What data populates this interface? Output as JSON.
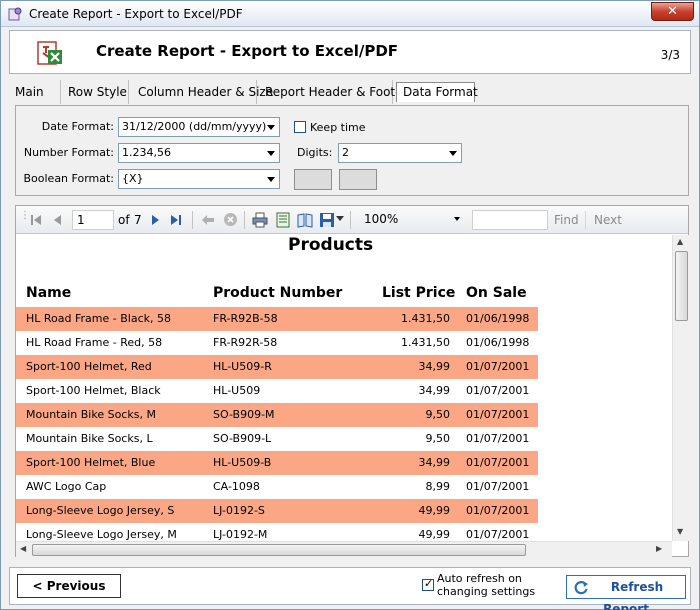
{
  "window": {
    "title": "Create Report - Export to Excel/PDF",
    "close_glyph": "✕"
  },
  "header": {
    "title": "Create Report - Export to Excel/PDF",
    "step": "3/3"
  },
  "tabs": [
    {
      "label": "Main"
    },
    {
      "label": "Row Style"
    },
    {
      "label": "Column Header & Size"
    },
    {
      "label": "Report Header & Footer"
    },
    {
      "label": "Data Format",
      "active": true
    }
  ],
  "format": {
    "date_label": "Date Format:",
    "date_value": "31/12/2000 (dd/mm/yyyy)",
    "keep_time_label": "Keep time",
    "keep_time_checked": false,
    "number_label": "Number Format:",
    "number_value": "1.234,56",
    "digits_label": "Digits:",
    "digits_value": "2",
    "boolean_label": "Boolean Format:",
    "boolean_value": "{X}"
  },
  "toolbar": {
    "page": "1",
    "of_label": "of",
    "total_pages": "7",
    "zoom": "100%",
    "find_label": "Find",
    "next_label": "Next"
  },
  "report": {
    "title": "Products",
    "columns": [
      "Name",
      "Product Number",
      "List Price",
      "On Sale"
    ],
    "rows": [
      [
        "HL Road Frame - Black, 58",
        "FR-R92B-58",
        "1.431,50",
        "01/06/1998"
      ],
      [
        "HL Road Frame - Red, 58",
        "FR-R92R-58",
        "1.431,50",
        "01/06/1998"
      ],
      [
        "Sport-100 Helmet, Red",
        "HL-U509-R",
        "34,99",
        "01/07/2001"
      ],
      [
        "Sport-100 Helmet, Black",
        "HL-U509",
        "34,99",
        "01/07/2001"
      ],
      [
        "Mountain Bike Socks, M",
        "SO-B909-M",
        "9,50",
        "01/07/2001"
      ],
      [
        "Mountain Bike Socks, L",
        "SO-B909-L",
        "9,50",
        "01/07/2001"
      ],
      [
        "Sport-100 Helmet, Blue",
        "HL-U509-B",
        "34,99",
        "01/07/2001"
      ],
      [
        "AWC Logo Cap",
        "CA-1098",
        "8,99",
        "01/07/2001"
      ],
      [
        "Long-Sleeve Logo Jersey, S",
        "LJ-0192-S",
        "49,99",
        "01/07/2001"
      ],
      [
        "Long-Sleeve Logo Jersey, M",
        "LJ-0192-M",
        "49,99",
        "01/07/2001"
      ]
    ],
    "highlight_color": "#fba786"
  },
  "footer": {
    "previous_label": "< Previous",
    "auto_refresh_line1": "Auto refresh on",
    "auto_refresh_line2": "changing settings",
    "auto_refresh_checked": true,
    "refresh_label": "Refresh Report"
  }
}
